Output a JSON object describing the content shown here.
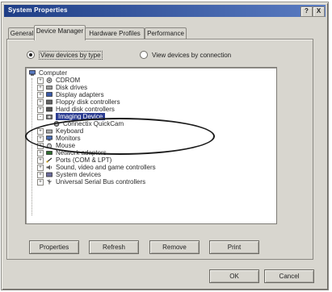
{
  "window": {
    "title": "System Properties",
    "help_glyph": "?",
    "close_glyph": "X"
  },
  "tabs": [
    {
      "label": "General"
    },
    {
      "label": "Device Manager"
    },
    {
      "label": "Hardware Profiles"
    },
    {
      "label": "Performance"
    }
  ],
  "view_options": {
    "by_type": "View devices by type",
    "by_connection": "View devices by connection",
    "selected": "by_type"
  },
  "tree": {
    "root": "Computer",
    "items": [
      {
        "label": "CDROM",
        "expander": "+"
      },
      {
        "label": "Disk drives",
        "expander": "+"
      },
      {
        "label": "Display adapters",
        "expander": "+"
      },
      {
        "label": "Floppy disk controllers",
        "expander": "+"
      },
      {
        "label": "Hard disk controllers",
        "expander": "+"
      },
      {
        "label": "Imaging Device",
        "expander": "-",
        "selected": true
      },
      {
        "label": "Connectix QuickCam",
        "child": true
      },
      {
        "label": "Keyboard",
        "expander": "+"
      },
      {
        "label": "Monitors",
        "expander": "+"
      },
      {
        "label": "Mouse",
        "expander": "+"
      },
      {
        "label": "Network adapters",
        "expander": "+"
      },
      {
        "label": "Ports (COM & LPT)",
        "expander": "+"
      },
      {
        "label": "Sound, video and game controllers",
        "expander": "+"
      },
      {
        "label": "System devices",
        "expander": "+"
      },
      {
        "label": "Universal Serial Bus controllers",
        "expander": "+"
      }
    ]
  },
  "panel_buttons": {
    "properties": "Properties",
    "refresh": "Refresh",
    "remove": "Remove",
    "print": "Print"
  },
  "dialog_buttons": {
    "ok": "OK",
    "cancel": "Cancel"
  },
  "colors": {
    "titlebar": "#1f3e86",
    "selection": "#2c3d92",
    "face": "#d8d6cf"
  }
}
